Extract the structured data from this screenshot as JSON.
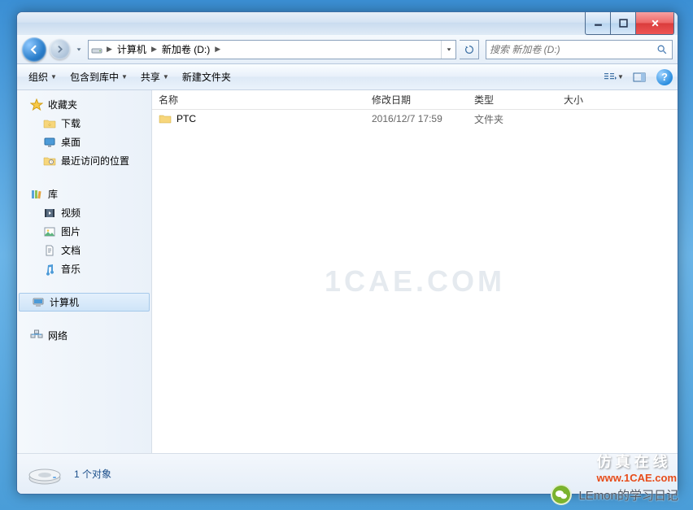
{
  "breadcrumb": {
    "root": "计算机",
    "vol": "新加卷 (D:)"
  },
  "search": {
    "placeholder": "搜索 新加卷 (D:)"
  },
  "toolbar": {
    "organize": "组织",
    "include": "包含到库中",
    "share": "共享",
    "newfolder": "新建文件夹"
  },
  "columns": {
    "name": "名称",
    "date": "修改日期",
    "type": "类型",
    "size": "大小"
  },
  "rows": [
    {
      "name": "PTC",
      "date": "2016/12/7 17:59",
      "type": "文件夹",
      "size": ""
    }
  ],
  "sidebar": {
    "fav_head": "收藏夹",
    "fav": {
      "downloads": "下载",
      "desktop": "桌面",
      "recent": "最近访问的位置"
    },
    "lib_head": "库",
    "lib": {
      "video": "视频",
      "pic": "图片",
      "doc": "文档",
      "music": "音乐"
    },
    "computer": "计算机",
    "network": "网络"
  },
  "status": {
    "text": "1 个对象"
  },
  "watermark": "1CAE.COM",
  "overlay": {
    "lemon": "LEmon的学习日记",
    "cae_cn": "仿 真 在 线",
    "cae_url": "www.1CAE.com"
  }
}
